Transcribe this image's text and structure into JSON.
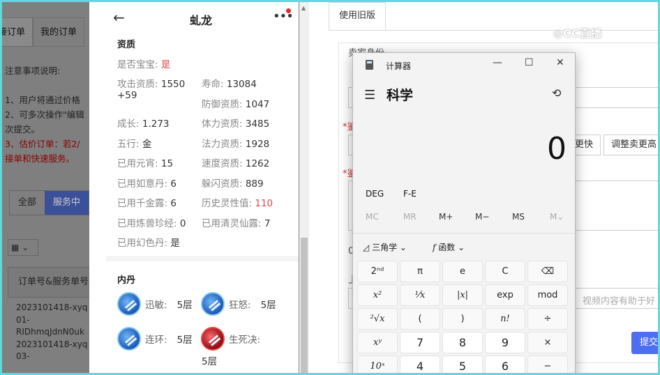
{
  "left_page": {
    "tabs": [
      "待接订单",
      "我的订单"
    ],
    "notes_title": "注意事项说明:",
    "notes": [
      "1、用户将通过价格",
      "2、可多次操作\"编辑",
      "次提交。"
    ],
    "notes_red": [
      "3、估价订单：若2/",
      "接单和快速服务。"
    ],
    "filters": [
      "全部",
      "服务中"
    ],
    "grid_label": "▦ ⌄",
    "table_header": "订单号&服务单号",
    "orders": [
      "2023101418-xyq",
      "01-",
      "RIDhmqJdnN0uk",
      "2023101418-xyq",
      "03-"
    ]
  },
  "mobile": {
    "back_icon": "←",
    "title": "虬龙",
    "more_icon": "•••",
    "section_aptitude": "资质",
    "attrs": [
      {
        "label": "是否宝宝:",
        "value": "是",
        "red": true
      },
      {
        "label": "攻击资质:",
        "value": "1550"
      },
      {
        "label": "+59",
        "value": ""
      },
      {
        "label": "寿命:",
        "value": "13084"
      },
      {
        "label": "防御资质:",
        "value": "1047"
      },
      {
        "label": "成长:",
        "value": "1.273"
      },
      {
        "label": "体力资质:",
        "value": "3485"
      },
      {
        "label": "五行:",
        "value": "金"
      },
      {
        "label": "法力资质:",
        "value": "1928"
      },
      {
        "label": "已用元宵:",
        "value": "15"
      },
      {
        "label": "速度资质:",
        "value": "1262"
      },
      {
        "label": "已用如意丹:",
        "value": "6"
      },
      {
        "label": "躲闪资质:",
        "value": "889"
      },
      {
        "label": "已用千金露:",
        "value": "6"
      },
      {
        "label": "历史灵性值:",
        "value": "110",
        "red": true
      },
      {
        "label": "已用炼兽珍经:",
        "value": "0"
      },
      {
        "label": "已用清灵仙露:",
        "value": "7"
      },
      {
        "label": "已用幻色丹:",
        "value": "是"
      }
    ],
    "section_neidan": "内丹",
    "skills": [
      {
        "name": "迅敏:",
        "level": "5层"
      },
      {
        "name": "狂怒:",
        "level": "5层"
      },
      {
        "name": "连环:",
        "level": "5层"
      },
      {
        "name": "生死决:",
        "level": "5层"
      }
    ]
  },
  "right_page": {
    "tab": "使用旧版",
    "seller_label": "卖家身份",
    "asterisk_1": "*鉴",
    "asterisk_2": "*鉴",
    "btn_faster": "更快",
    "btn_adjust": "调整卖更高",
    "zero": "0",
    "upload_mark": "上",
    "video_hint": "视频内容有助于好",
    "submit": "提交"
  },
  "watermark": "◎CC直播",
  "calculator": {
    "title": "计算器",
    "minimize": "—",
    "maximize": "☐",
    "close": "✕",
    "menu_icon": "☰",
    "mode": "科学",
    "history_icon": "⟲",
    "display": "0",
    "deg": "DEG",
    "fe": "F-E",
    "memory": [
      "MC",
      "MR",
      "M+",
      "M−",
      "MS",
      "M⌄"
    ],
    "trig": "三角学",
    "func": "函数",
    "keys": [
      "2ⁿᵈ",
      "π",
      "e",
      "C",
      "⌫",
      "x²",
      "¹⁄x",
      "|x|",
      "exp",
      "mod",
      "²√x",
      "(",
      ")",
      "n!",
      "÷",
      "xʸ",
      "7",
      "8",
      "9",
      "×",
      "10ˣ",
      "4",
      "5",
      "6",
      "−"
    ]
  }
}
